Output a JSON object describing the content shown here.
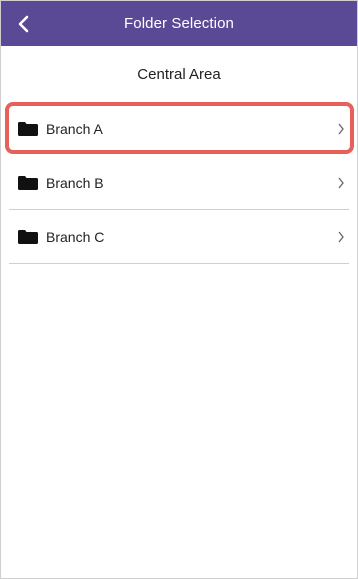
{
  "appbar": {
    "title": "Folder Selection",
    "back_icon": "chevron-left-icon",
    "background_color": "#5a4a96"
  },
  "subheader": {
    "title": "Central Area"
  },
  "folders": [
    {
      "label": "Branch A",
      "icon": "folder-icon",
      "selected": true
    },
    {
      "label": "Branch B",
      "icon": "folder-icon",
      "selected": false
    },
    {
      "label": "Branch C",
      "icon": "folder-icon",
      "selected": false
    }
  ],
  "colors": {
    "highlight": "#e8605a",
    "divider": "#cfcfcf"
  }
}
